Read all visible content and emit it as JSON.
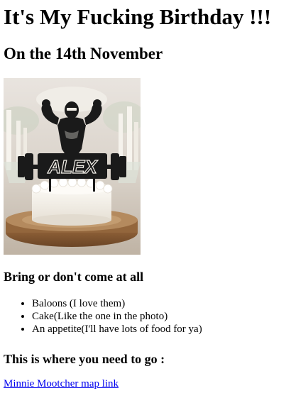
{
  "title": "It's My Fucking Birthday !!!",
  "date_heading": "On the 14th November",
  "photo": {
    "topper_name": "ALEX",
    "alt": "Birthday cake with a bodybuilder ALEX topper"
  },
  "bring_heading": "Bring or don't come at all",
  "bring_items": [
    "Baloons (I love them)",
    "Cake(Like the one in the photo)",
    "An appetite(I'll have lots of food for ya)"
  ],
  "location_heading": "This is where you need to go :",
  "map_link": {
    "label": "Minnie Mootcher map link"
  },
  "colors": {
    "link": "#0000ee",
    "text": "#000000",
    "background": "#ffffff"
  }
}
